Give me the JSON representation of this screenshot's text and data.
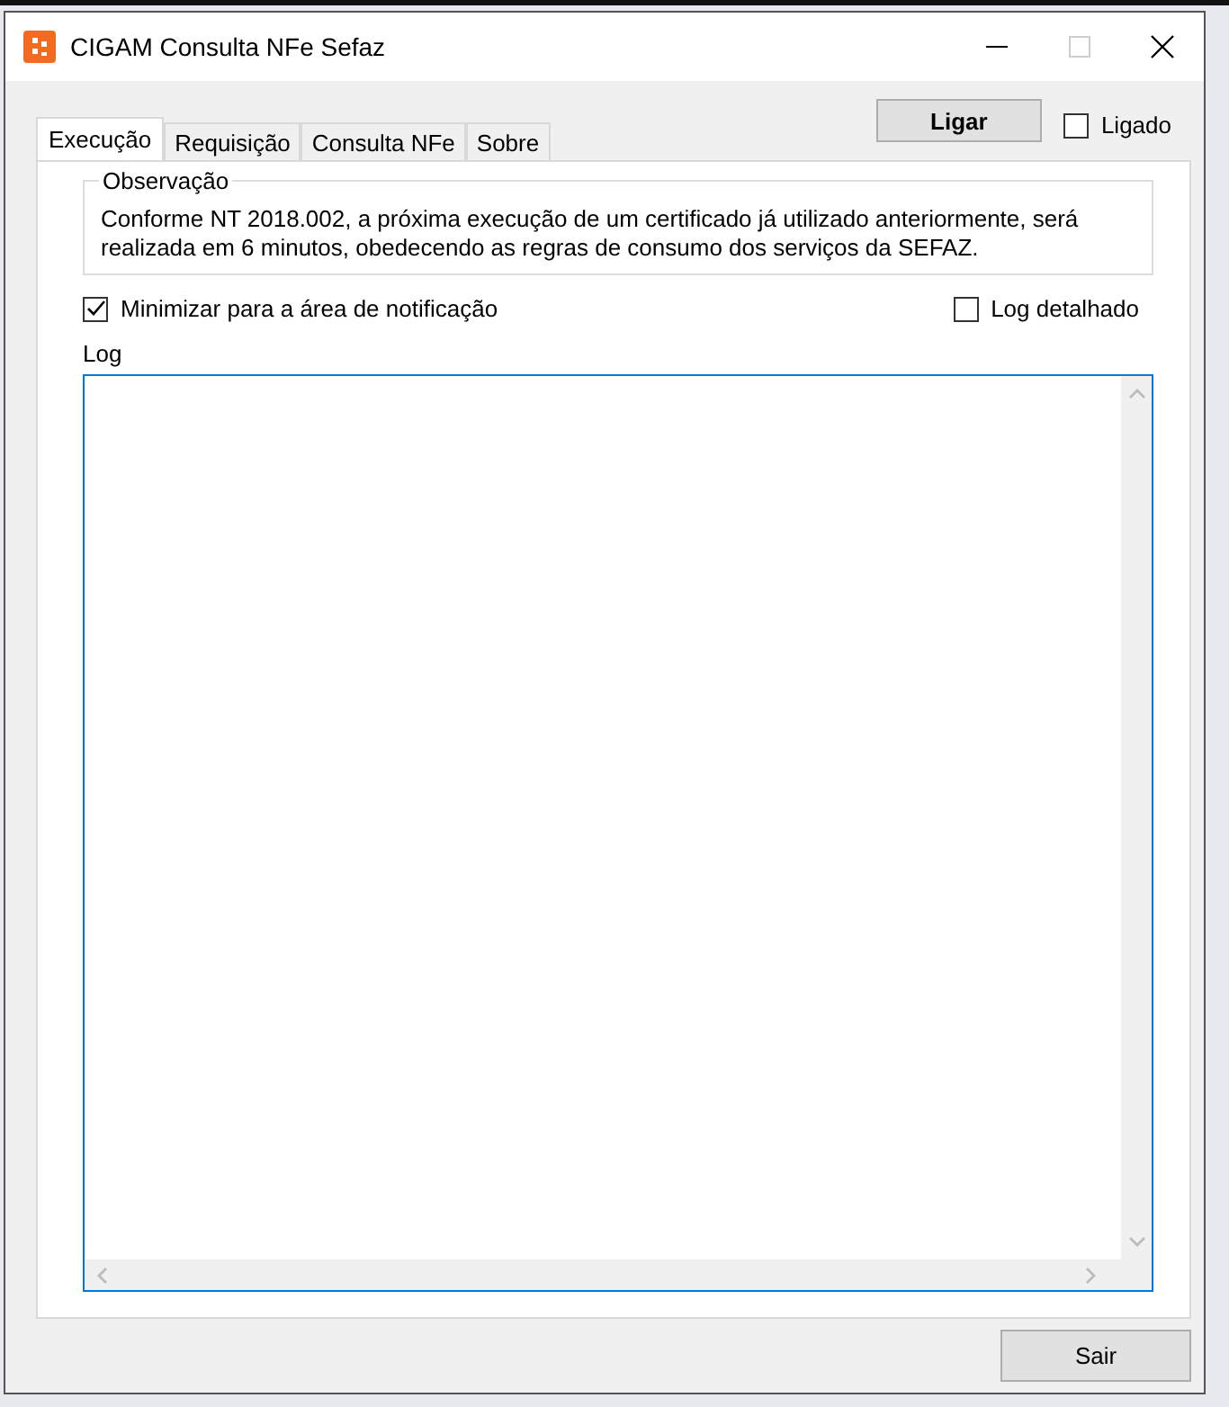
{
  "window": {
    "title": "CIGAM Consulta NFe Sefaz"
  },
  "tabs": [
    {
      "label": "Execução",
      "selected": true
    },
    {
      "label": "Requisição",
      "selected": false
    },
    {
      "label": "Consulta NFe",
      "selected": false
    },
    {
      "label": "Sobre",
      "selected": false
    }
  ],
  "connect_button": "Ligar",
  "connected": {
    "label": "Ligado",
    "checked": false
  },
  "observation": {
    "title": "Observação",
    "text": "Conforme NT 2018.002, a próxima execução de um certificado já utilizado anteriormente, será realizada em 6 minutos, obedecendo as regras de consumo dos serviços da SEFAZ."
  },
  "options": [
    {
      "label": "Minimizar para a área de notificação",
      "checked": true
    },
    {
      "label": "Log detalhado",
      "checked": false
    }
  ],
  "log": {
    "label": "Log"
  },
  "exit_button": "Sair"
}
